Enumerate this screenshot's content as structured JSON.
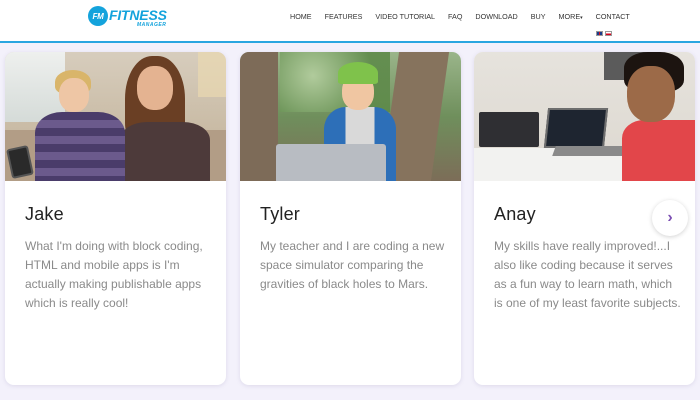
{
  "header": {
    "logo": {
      "badge": "FM",
      "title": "FITNESS",
      "subtitle": "MANAGER"
    },
    "nav": [
      {
        "label": "HOME"
      },
      {
        "label": "FEATURES"
      },
      {
        "label": "VIDEO TUTORIAL"
      },
      {
        "label": "FAQ"
      },
      {
        "label": "DOWNLOAD"
      },
      {
        "label": "BUY"
      },
      {
        "label": "MORE"
      },
      {
        "label": "CONTACT"
      }
    ],
    "more_caret": "▾"
  },
  "cards": [
    {
      "name": "Jake",
      "text": "What I'm doing with block coding, HTML and mobile apps is I'm actually making publishable apps which is really cool!"
    },
    {
      "name": "Tyler",
      "text": "My teacher and I are coding a new space simulator comparing the gravities of black holes to Mars."
    },
    {
      "name": "Anay",
      "text": "My skills have really improved!...I also like coding because it serves as a fun way to learn math, which is one of my least favorite subjects."
    }
  ],
  "carousel": {
    "next_icon": "›"
  },
  "colors": {
    "brand": "#14a3dc",
    "accent": "#7c4fb3",
    "header_rule": "#2aa6e0"
  }
}
